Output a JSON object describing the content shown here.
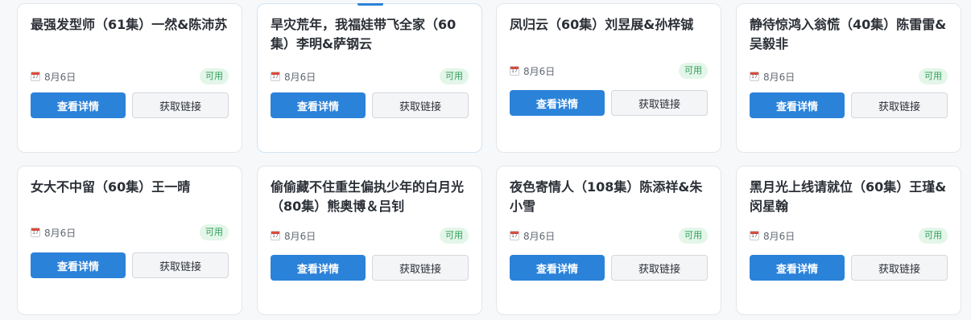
{
  "cards": [
    {
      "title": "最强发型师（61集）一然&陈沛苏",
      "date": "8月6日",
      "status": "可用",
      "detail_label": "查看详情",
      "link_label": "获取链接"
    },
    {
      "title": "旱灾荒年，我福娃带飞全家（60集）李明&萨钢云",
      "date": "8月6日",
      "status": "可用",
      "detail_label": "查看详情",
      "link_label": "获取链接"
    },
    {
      "title": "凤归云（60集）刘昱展&孙梓铖",
      "date": "8月6日",
      "status": "可用",
      "detail_label": "查看详情",
      "link_label": "获取链接"
    },
    {
      "title": "静待惊鸿入翁慌（40集）陈雷雷&吴毅非",
      "date": "8月6日",
      "status": "可用",
      "detail_label": "查看详情",
      "link_label": "获取链接"
    },
    {
      "title": "女大不中留（60集）王一晴",
      "date": "8月6日",
      "status": "可用",
      "detail_label": "查看详情",
      "link_label": "获取链接"
    },
    {
      "title": "偷偷藏不住重生偏执少年的白月光（80集）熊奥博＆吕钊",
      "date": "8月6日",
      "status": "可用",
      "detail_label": "查看详情",
      "link_label": "获取链接"
    },
    {
      "title": "夜色寄情人（108集）陈添祥&朱小雪",
      "date": "8月6日",
      "status": "可用",
      "detail_label": "查看详情",
      "link_label": "获取链接"
    },
    {
      "title": "黑月光上线请就位（60集）王瑾&闵星翰",
      "date": "8月6日",
      "status": "可用",
      "detail_label": "查看详情",
      "link_label": "获取链接"
    }
  ],
  "colors": {
    "primary_button": "#2b82d9",
    "status_badge_text": "#2f9e58",
    "status_badge_bg": "#e3f6e9"
  },
  "icons": {
    "date": "calendar-icon"
  }
}
